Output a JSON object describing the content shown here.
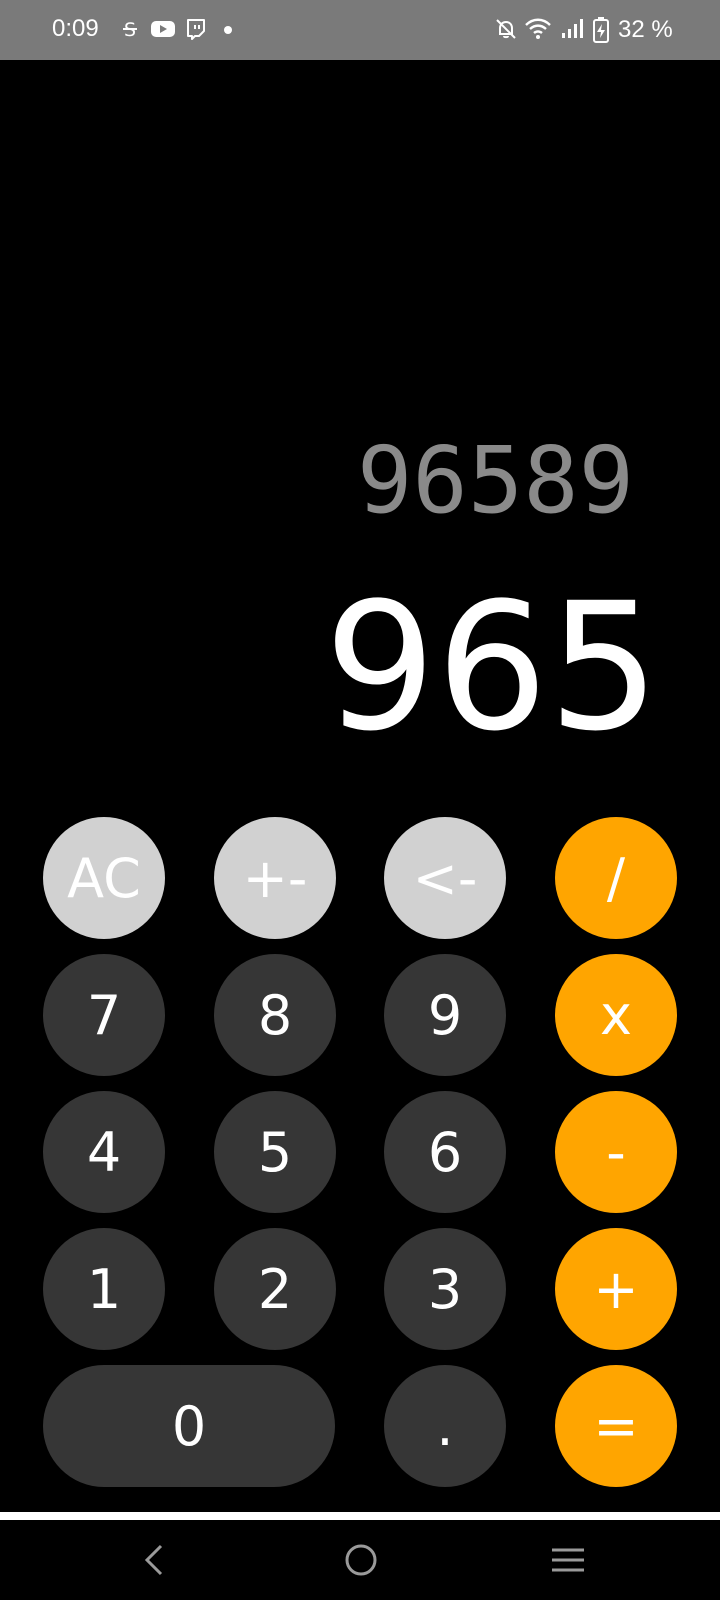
{
  "status_bar": {
    "time": "0:09",
    "battery_text": "32 %",
    "left_icons": [
      "strikethrough-s-icon",
      "youtube-icon",
      "twitch-icon",
      "notification-dot-icon"
    ],
    "right_icons": [
      "bell-off-icon",
      "wifi-icon",
      "signal-icon",
      "battery-charging-icon"
    ],
    "background": "#7a7a7a"
  },
  "display": {
    "expression": "96589",
    "result": "965"
  },
  "keys": {
    "ac": "AC",
    "plus_minus": "+-",
    "backspace": "<-",
    "divide": "/",
    "seven": "7",
    "eight": "8",
    "nine": "9",
    "multiply": "x",
    "four": "4",
    "five": "5",
    "six": "6",
    "minus": "-",
    "one": "1",
    "two": "2",
    "three": "3",
    "plus": "+",
    "zero": "0",
    "decimal": ".",
    "equals": "="
  },
  "colors": {
    "function_key": "#d1d1d1",
    "digit_key": "#363636",
    "operator_key": "#ffa500",
    "expression_text": "#8a8a8a",
    "result_text": "#ffffff"
  },
  "nav_bar": {
    "icons": [
      "back-icon",
      "home-icon",
      "recents-icon"
    ]
  }
}
